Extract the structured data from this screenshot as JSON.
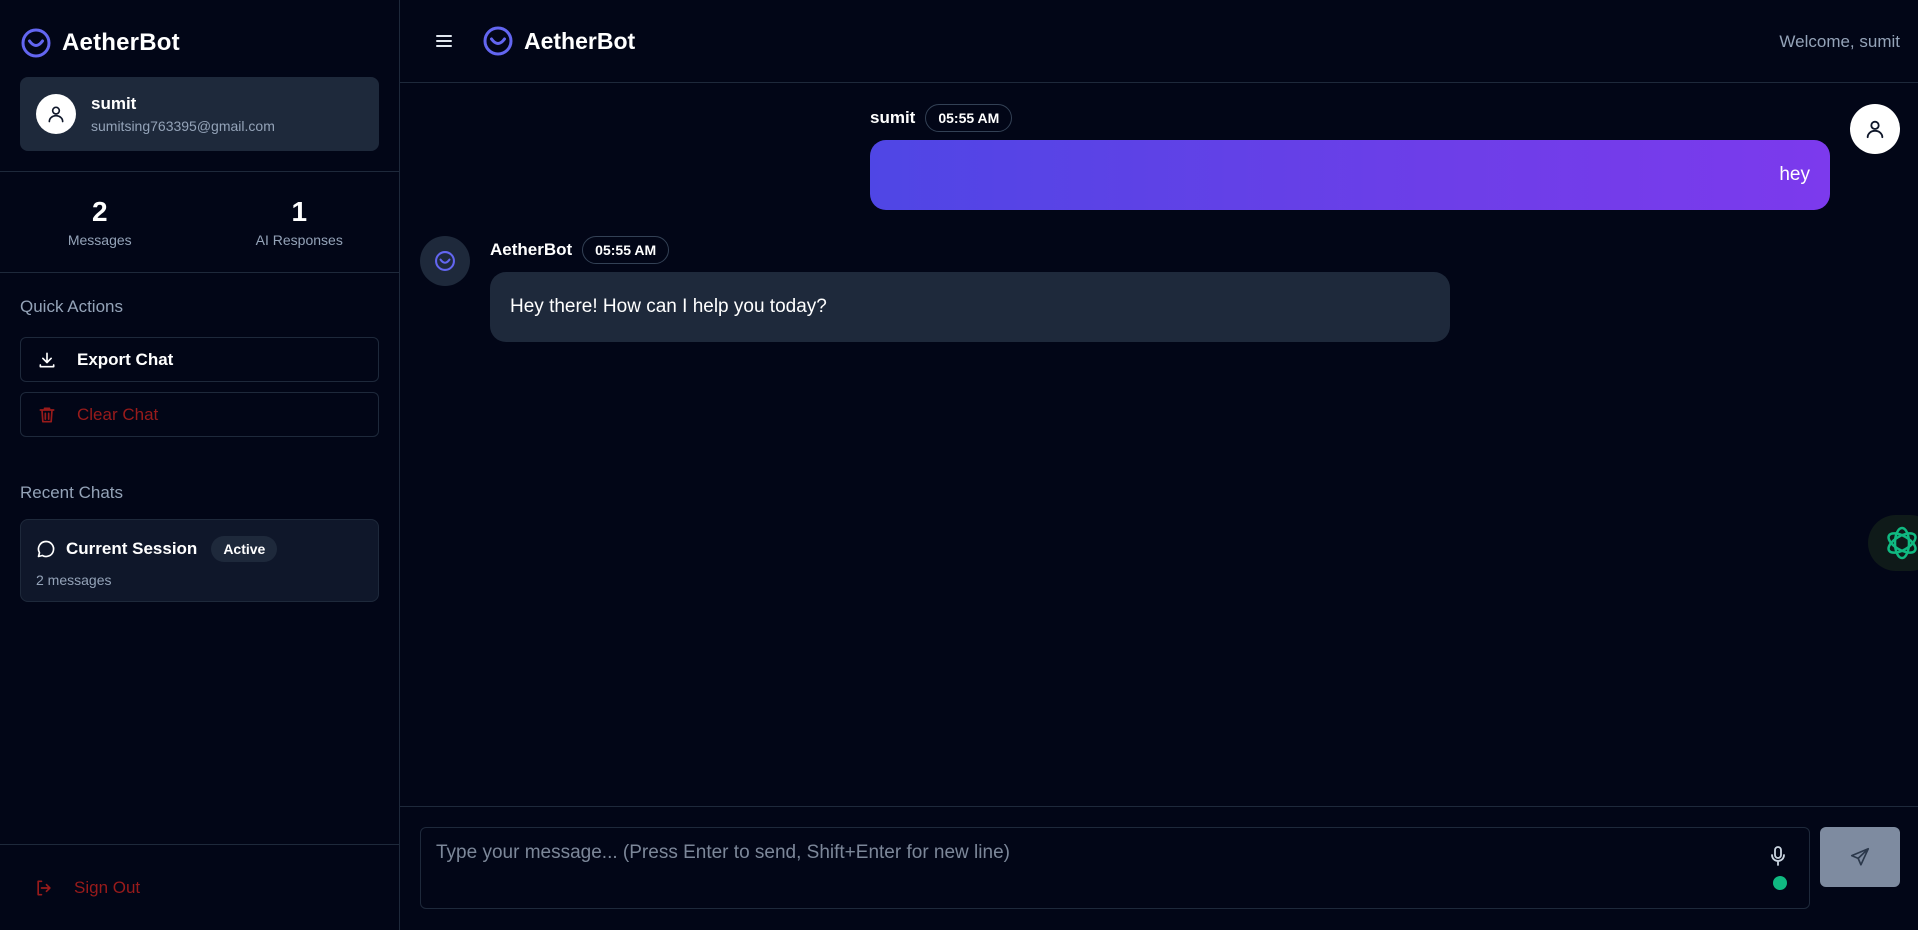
{
  "app": {
    "brand": "AetherBot"
  },
  "sidebar": {
    "user": {
      "name": "sumit",
      "email": "sumitsing763395@gmail.com"
    },
    "stats": [
      {
        "value": "2",
        "label": "Messages"
      },
      {
        "value": "1",
        "label": "AI Responses"
      }
    ],
    "quick_actions_title": "Quick Actions",
    "export_label": "Export Chat",
    "clear_label": "Clear Chat",
    "recent_title": "Recent Chats",
    "recent": {
      "title": "Current Session",
      "badge": "Active",
      "subtitle": "2 messages"
    },
    "signout_label": "Sign Out"
  },
  "header": {
    "brand": "AetherBot",
    "welcome": "Welcome, sumit"
  },
  "messages": [
    {
      "author": "sumit",
      "time": "05:55 AM",
      "text": "hey"
    },
    {
      "author": "AetherBot",
      "time": "05:55 AM",
      "text": "Hey there! How can I help you today?"
    }
  ],
  "composer": {
    "placeholder": "Type your message... (Press Enter to send, Shift+Enter for new line)"
  },
  "colors": {
    "background": "#020617",
    "accent": "#6366f1",
    "danger": "#991b1b",
    "online": "#10b981"
  }
}
